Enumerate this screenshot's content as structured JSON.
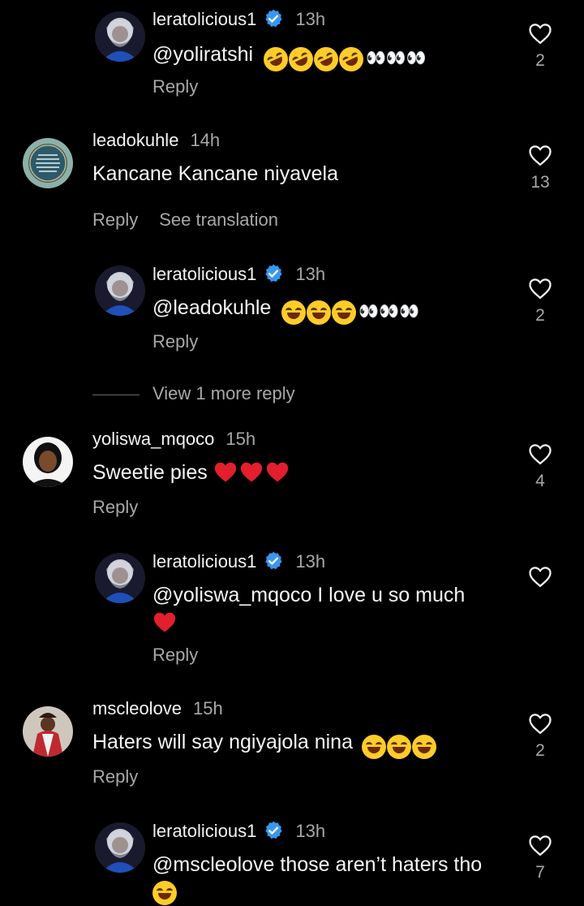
{
  "comments": [
    {
      "username": "leratolicious1",
      "verified": true,
      "time": "13h",
      "mention": "@yoliratshi",
      "text": "",
      "emoji_label": "🤣🤣🤣🤣👀👀👀",
      "reply": "Reply",
      "likes": "2"
    },
    {
      "username": "leadokuhle",
      "verified": false,
      "time": "14h",
      "mention": "",
      "text": "Kancane Kancane niyavela",
      "reply": "Reply",
      "translate": "See translation",
      "likes": "13"
    },
    {
      "username": "leratolicious1",
      "verified": true,
      "time": "13h",
      "mention": "@leadokuhle",
      "text": "",
      "emoji_label": "😂😂😂👀👀👀",
      "reply": "Reply",
      "likes": "2"
    },
    {
      "username": "yoliswa_mqoco",
      "verified": false,
      "time": "15h",
      "mention": "",
      "text": "Sweetie pies",
      "emoji_label": "❤️❤️❤️",
      "reply": "Reply",
      "likes": "4"
    },
    {
      "username": "leratolicious1",
      "verified": true,
      "time": "13h",
      "mention": "@yoliswa_mqoco",
      "text": " I love u so much",
      "emoji_label": "❤️",
      "reply": "Reply",
      "likes": ""
    },
    {
      "username": "mscleolove",
      "verified": false,
      "time": "15h",
      "mention": "",
      "text": "Haters will say ngiyajola nina",
      "emoji_label": "😂😂😂",
      "reply": "Reply",
      "likes": "2"
    },
    {
      "username": "leratolicious1",
      "verified": true,
      "time": "13h",
      "mention": "@mscleolove",
      "text": " those aren’t haters tho",
      "emoji_label": "😂",
      "reply": "",
      "likes": "7"
    }
  ],
  "view_more": "View 1 more reply",
  "icons": {
    "like": "heart-outline-icon",
    "verified": "verified-badge-icon"
  },
  "colors": {
    "background": "#000000",
    "verified": "#3897f0",
    "secondary_text": "#a8a8a8"
  }
}
